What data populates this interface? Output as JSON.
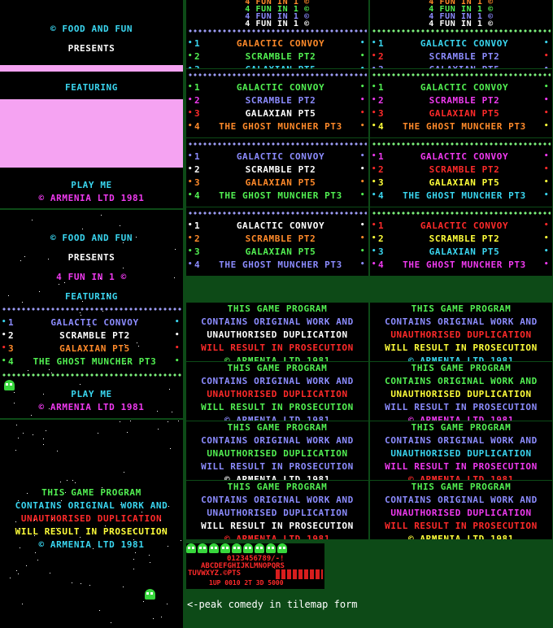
{
  "colors": {
    "white": "#ffffff",
    "cyan": "#3ad6f0",
    "green": "#52f052",
    "orange": "#ff8a2a",
    "red": "#ff2a2a",
    "yellow": "#ffff3a",
    "magenta": "#f03af0",
    "blue": "#8c8cff",
    "pink": "#f5a3f2"
  },
  "intro1": {
    "line1": "© FOOD AND FUN",
    "line2": "PRESENTS",
    "featuring": "FEATURING",
    "play": "PLAY ME",
    "copyright": "© ARMENIA LTD 1981"
  },
  "intro2": {
    "line1": "© FOOD AND FUN",
    "line2": "PRESENTS",
    "line3": "4 FUN IN 1 ©",
    "featuring": "FEATURING",
    "play": "PLAY ME",
    "copyright": "© ARMENIA LTD 1981"
  },
  "warning": {
    "l1": "THIS GAME PROGRAM",
    "l2": "CONTAINS ORIGINAL WORK AND",
    "l3": "UNAUTHORISED DUPLICATION",
    "l4": "WILL RESULT IN PROSECUTION",
    "l5": "© ARMENIA LTD 1981"
  },
  "title_lines": [
    "4 FUN IN 1 ©",
    "4 FUN IN 1 ©",
    "4 FUN IN 1 ©",
    "4 FUN IN 1 ©"
  ],
  "games": [
    "GALACTIC CONVOY",
    "SCRAMBLE PT2",
    "GALAXIAN PT5",
    "THE GHOST MUNCHER PT3"
  ],
  "numbers": [
    "1",
    "2",
    "3",
    "4"
  ],
  "tilemap": {
    "digits": "0123456789/-!",
    "letters1": "ABCDEFGHIJKLMNOPQRS",
    "letters2": "TUVWXYZ.©PTS",
    "score": "1UP 0010 2T 3D 5000"
  },
  "caption": "<-peak comedy in tilemap form"
}
